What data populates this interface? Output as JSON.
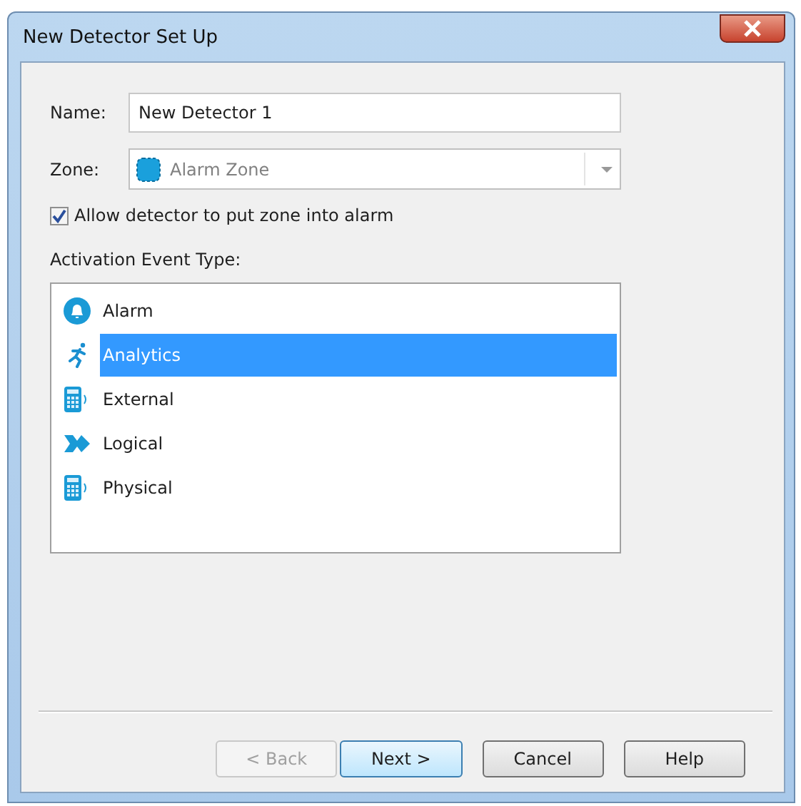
{
  "window": {
    "title": "New Detector Set Up"
  },
  "name_field": {
    "label": "Name:",
    "value": "New Detector 1"
  },
  "zone_field": {
    "label": "Zone:",
    "value": "Alarm Zone",
    "disabled": true
  },
  "allow_alarm": {
    "label": "Allow detector to put zone into alarm",
    "checked": true
  },
  "activation": {
    "label": "Activation Event Type:",
    "items": [
      {
        "label": "Alarm",
        "kind": "bell",
        "selected": false
      },
      {
        "label": "Analytics",
        "kind": "runner",
        "selected": true
      },
      {
        "label": "External",
        "kind": "device",
        "selected": false
      },
      {
        "label": "Logical",
        "kind": "arrow",
        "selected": false
      },
      {
        "label": "Physical",
        "kind": "device",
        "selected": false
      }
    ]
  },
  "buttons": [
    {
      "label": "< Back",
      "disabled": true,
      "default": false
    },
    {
      "label": "Next >",
      "disabled": false,
      "default": true
    },
    {
      "label": "Cancel",
      "disabled": false,
      "default": false
    },
    {
      "label": "Help",
      "disabled": false,
      "default": false
    }
  ]
}
